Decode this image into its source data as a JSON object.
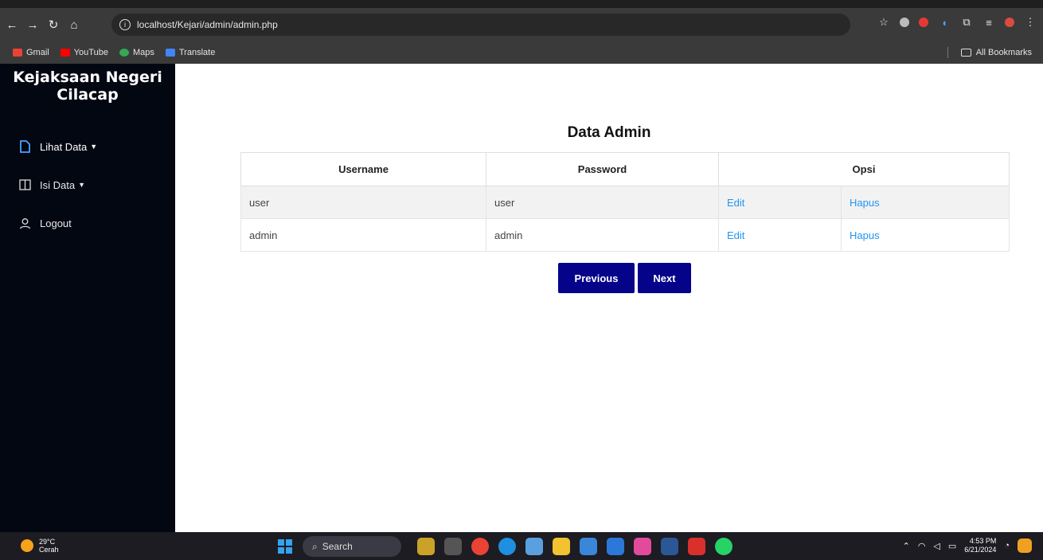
{
  "browser": {
    "url": "localhost/Kejari/admin/admin.php",
    "bookmarks": [
      "Gmail",
      "YouTube",
      "Maps",
      "Translate"
    ],
    "all_bookmarks": "All Bookmarks"
  },
  "sidebar": {
    "brand": "Kejaksaan Negeri Cilacap",
    "items": [
      {
        "label": "Lihat Data",
        "icon": "file-icon"
      },
      {
        "label": "Isi Data",
        "icon": "book-icon"
      },
      {
        "label": "Logout",
        "icon": "user-icon"
      }
    ]
  },
  "main": {
    "title": "Data Admin",
    "headers": [
      "Username",
      "Password",
      "Opsi"
    ],
    "rows": [
      {
        "username": "user",
        "password": "user",
        "edit": "Edit",
        "hapus": "Hapus"
      },
      {
        "username": "admin",
        "password": "admin",
        "edit": "Edit",
        "hapus": "Hapus"
      }
    ],
    "previous": "Previous",
    "next": "Next"
  },
  "taskbar": {
    "temp": "29°C",
    "weather": "Cerah",
    "search": "Search",
    "time": "4:53 PM",
    "date": "6/21/2024"
  },
  "colors": {
    "sidebar": "#030712",
    "button": "#05038a",
    "link": "#2196f3"
  }
}
